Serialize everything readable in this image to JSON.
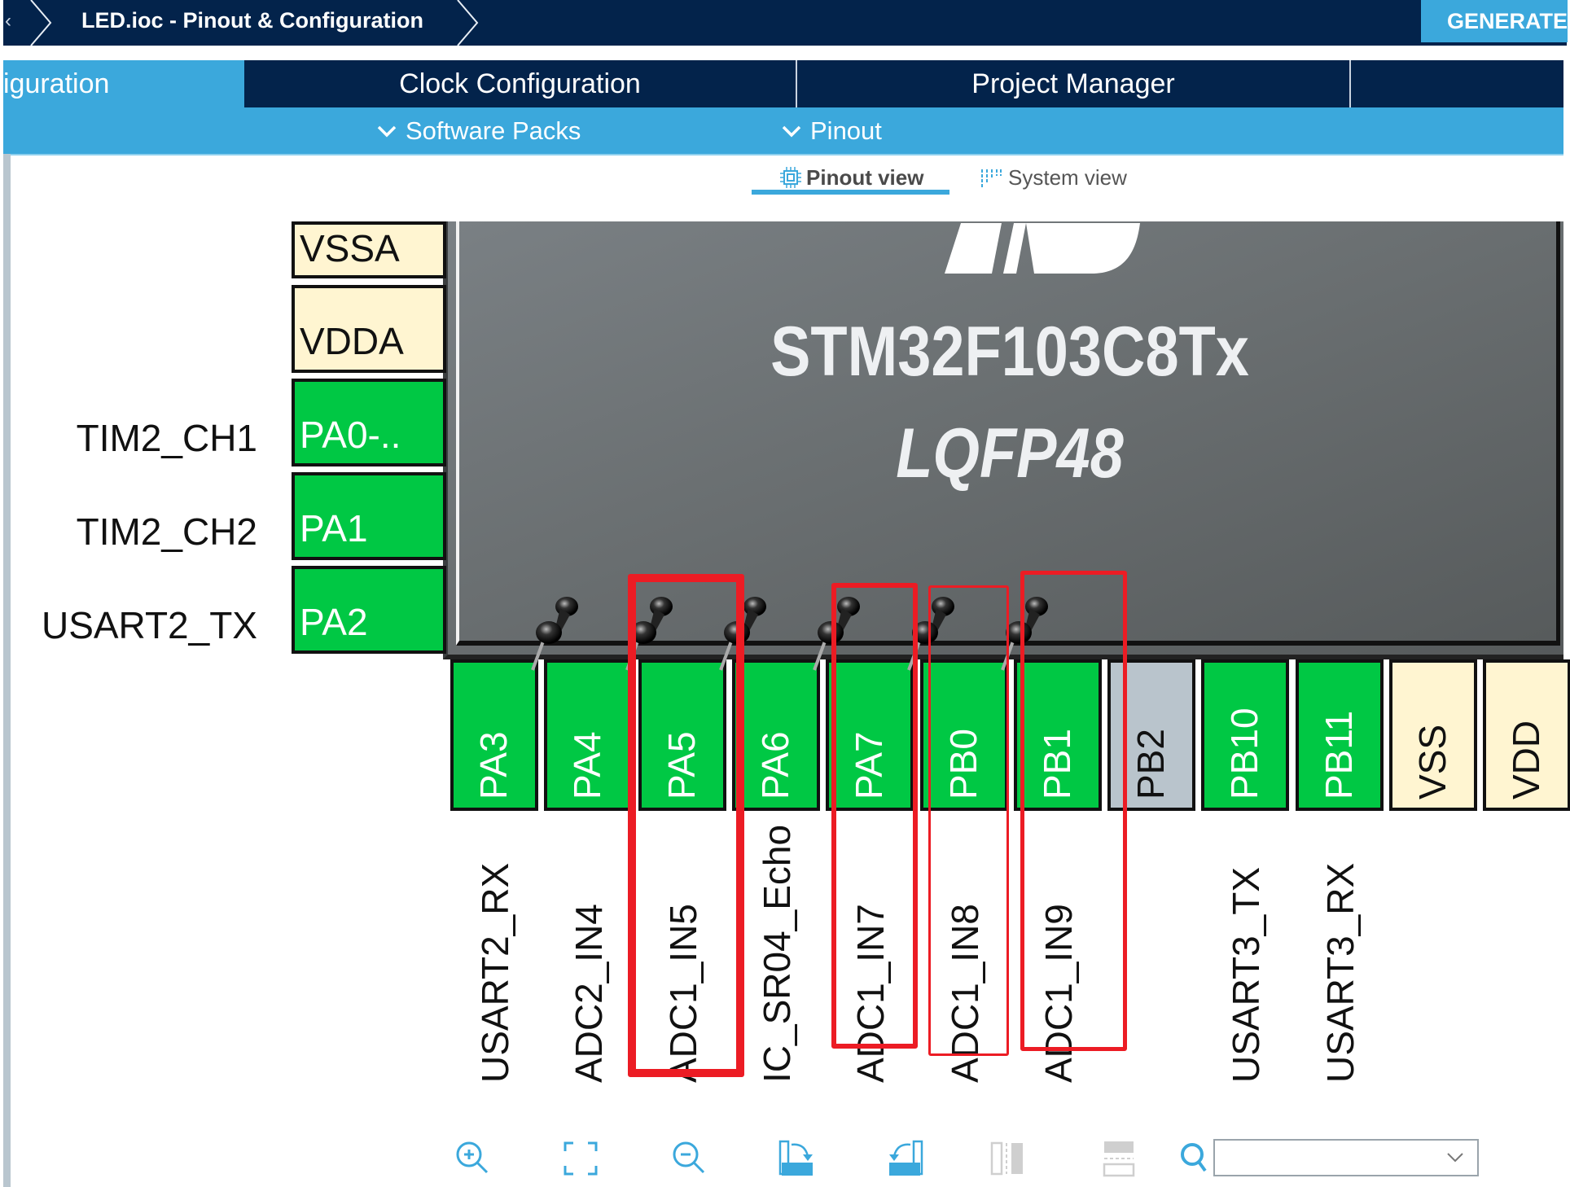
{
  "topbar": {
    "prev_crumb": "‹",
    "title": "LED.ioc - Pinout & Configuration",
    "generate_label": "GENERATE CODE"
  },
  "tabs": [
    {
      "label": "Pinout & Configuration",
      "visible_label": "iguration",
      "active": true
    },
    {
      "label": "Clock Configuration",
      "active": false
    },
    {
      "label": "Project Manager",
      "active": false
    },
    {
      "label": "",
      "active": false
    }
  ],
  "subbar": {
    "software_packs": "Software Packs",
    "pinout": "Pinout"
  },
  "view_tabs": {
    "pinout_view": "Pinout view",
    "system_view": "System view",
    "active": "pinout_view"
  },
  "chip": {
    "name": "STM32F103C8Tx",
    "package": "LQFP48"
  },
  "left_pins": [
    {
      "pin": "VSSA",
      "type": "power",
      "signal": ""
    },
    {
      "pin": "VDDA",
      "type": "power",
      "signal": ""
    },
    {
      "pin": "PA0-..",
      "type": "gpio",
      "signal": "TIM2_CH1"
    },
    {
      "pin": "PA1",
      "type": "gpio",
      "signal": "TIM2_CH2"
    },
    {
      "pin": "PA2",
      "type": "gpio",
      "signal": "USART2_TX"
    }
  ],
  "bottom_pins": [
    {
      "pin": "PA3",
      "type": "gpio",
      "signal": "USART2_RX",
      "pinned": false
    },
    {
      "pin": "PA4",
      "type": "gpio",
      "signal": "ADC2_IN4",
      "pinned": true
    },
    {
      "pin": "PA5",
      "type": "gpio",
      "signal": "ADC1_IN5",
      "pinned": true
    },
    {
      "pin": "PA6",
      "type": "gpio",
      "signal": "IC_SR04_Echo",
      "pinned": true
    },
    {
      "pin": "PA7",
      "type": "gpio",
      "signal": "ADC1_IN7",
      "pinned": true
    },
    {
      "pin": "PB0",
      "type": "gpio",
      "signal": "ADC1_IN8",
      "pinned": true
    },
    {
      "pin": "PB1",
      "type": "gpio",
      "signal": "ADC1_IN9",
      "pinned": true
    },
    {
      "pin": "PB2",
      "type": "unused",
      "signal": "",
      "pinned": false
    },
    {
      "pin": "PB10",
      "type": "gpio",
      "signal": "USART3_TX",
      "pinned": false
    },
    {
      "pin": "PB11",
      "type": "gpio",
      "signal": "USART3_RX",
      "pinned": false
    },
    {
      "pin": "VSS",
      "type": "power",
      "signal": "",
      "pinned": false
    },
    {
      "pin": "VDD",
      "type": "power",
      "signal": "",
      "pinned": false
    }
  ],
  "highlights": [
    "PA5",
    "PA7",
    "PB0",
    "PB1"
  ],
  "colors": {
    "navy": "#03234b",
    "accent_blue": "#3ba8dc",
    "pin_green": "#00c844",
    "pin_power": "#fff5d1",
    "pin_unused": "#b9c4cc",
    "highlight_red": "#ec1c24"
  },
  "toolbar": {
    "tools": [
      "zoom-in",
      "fit-to-screen",
      "zoom-out",
      "rotate-right",
      "rotate-left",
      "vertical-split",
      "horizontal-split"
    ],
    "search_value": "",
    "search_placeholder": ""
  }
}
